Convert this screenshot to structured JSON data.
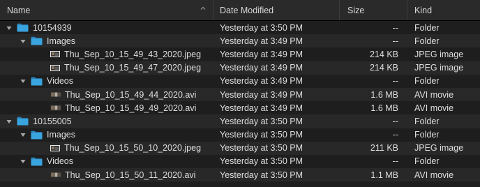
{
  "columns": {
    "name": "Name",
    "date": "Date Modified",
    "size": "Size",
    "kind": "Kind"
  },
  "colors": {
    "folder": "#3aa4df",
    "folder_dark": "#2a86bd",
    "background": "#1e1e1e",
    "row_alt": "#282828"
  },
  "rows": [
    {
      "type": "folder",
      "level": 0,
      "name": "10154939",
      "date": "Yesterday at 3:50 PM",
      "size": "--",
      "kind": "Folder",
      "icon": "folder-icon"
    },
    {
      "type": "folder",
      "level": 1,
      "name": "Images",
      "date": "Yesterday at 3:49 PM",
      "size": "--",
      "kind": "Folder",
      "icon": "folder-icon"
    },
    {
      "type": "image",
      "level": 2,
      "name": "Thu_Sep_10_15_49_43_2020.jpeg",
      "date": "Yesterday at 3:49 PM",
      "size": "214 KB",
      "kind": "JPEG image",
      "icon": "jpeg-thumbnail-icon"
    },
    {
      "type": "image",
      "level": 2,
      "name": "Thu_Sep_10_15_49_47_2020.jpeg",
      "date": "Yesterday at 3:49 PM",
      "size": "214 KB",
      "kind": "JPEG image",
      "icon": "jpeg-thumbnail-icon"
    },
    {
      "type": "folder",
      "level": 1,
      "name": "Videos",
      "date": "Yesterday at 3:49 PM",
      "size": "--",
      "kind": "Folder",
      "icon": "folder-icon"
    },
    {
      "type": "video",
      "level": 2,
      "name": "Thu_Sep_10_15_49_44_2020.avi",
      "date": "Yesterday at 3:49 PM",
      "size": "1.6 MB",
      "kind": "AVI movie",
      "icon": "avi-thumbnail-icon"
    },
    {
      "type": "video",
      "level": 2,
      "name": "Thu_Sep_10_15_49_49_2020.avi",
      "date": "Yesterday at 3:49 PM",
      "size": "1.6 MB",
      "kind": "AVI movie",
      "icon": "avi-thumbnail-icon"
    },
    {
      "type": "folder",
      "level": 0,
      "name": "10155005",
      "date": "Yesterday at 3:50 PM",
      "size": "--",
      "kind": "Folder",
      "icon": "folder-icon"
    },
    {
      "type": "folder",
      "level": 1,
      "name": "Images",
      "date": "Yesterday at 3:50 PM",
      "size": "--",
      "kind": "Folder",
      "icon": "folder-icon"
    },
    {
      "type": "image",
      "level": 2,
      "name": "Thu_Sep_10_15_50_10_2020.jpeg",
      "date": "Yesterday at 3:50 PM",
      "size": "211 KB",
      "kind": "JPEG image",
      "icon": "jpeg-thumbnail-icon"
    },
    {
      "type": "folder",
      "level": 1,
      "name": "Videos",
      "date": "Yesterday at 3:50 PM",
      "size": "--",
      "kind": "Folder",
      "icon": "folder-icon"
    },
    {
      "type": "video",
      "level": 2,
      "name": "Thu_Sep_10_15_50_11_2020.avi",
      "date": "Yesterday at 3:50 PM",
      "size": "1.1 MB",
      "kind": "AVI movie",
      "icon": "avi-thumbnail-icon"
    }
  ]
}
